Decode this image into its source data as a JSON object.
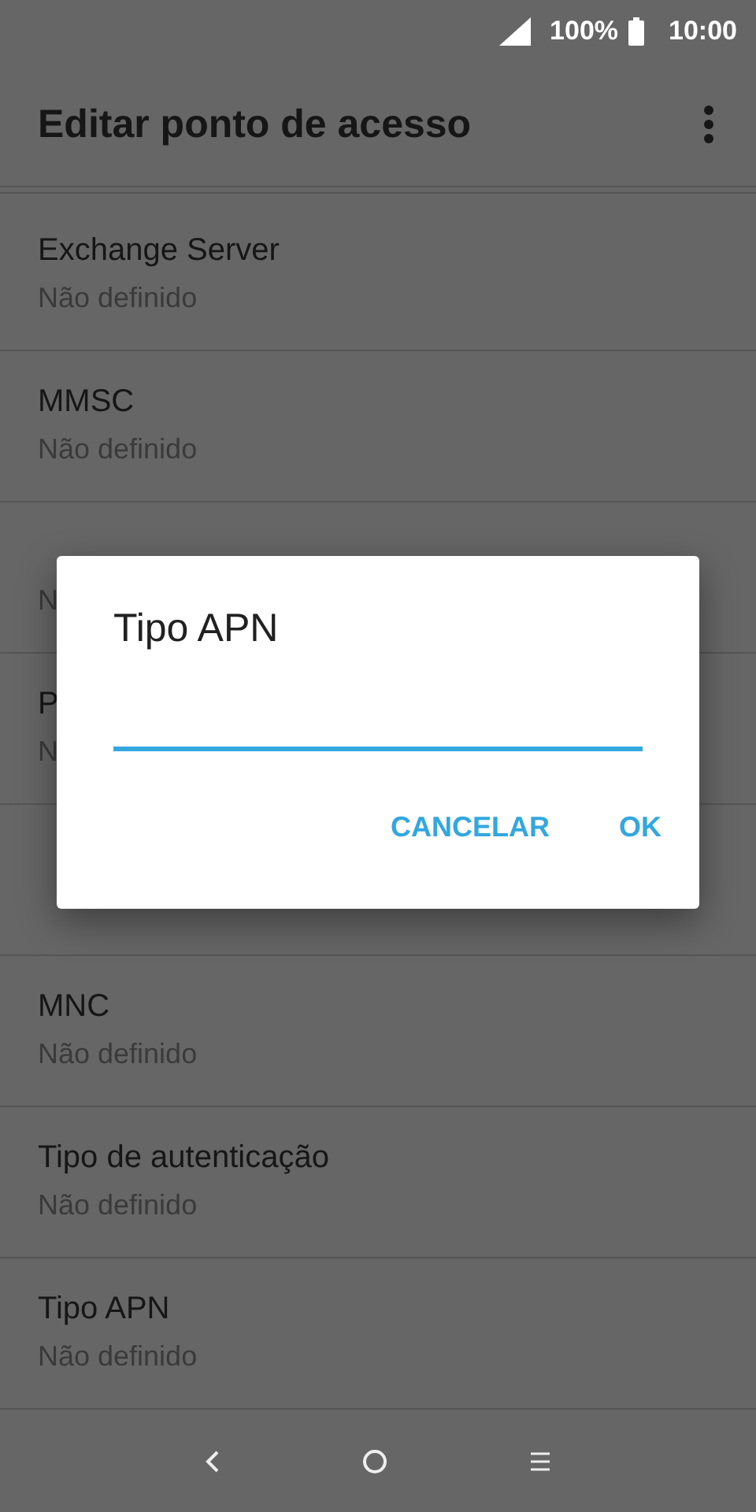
{
  "status_bar": {
    "battery": "100%",
    "time": "10:00"
  },
  "app_bar": {
    "title": "Editar ponto de acesso"
  },
  "settings": [
    {
      "kind": "item",
      "title": "Exchange Server",
      "summary": "Não definido"
    },
    {
      "kind": "item",
      "title": "MMSC",
      "summary": "Não definido"
    },
    {
      "kind": "item",
      "summary": "N"
    },
    {
      "kind": "item",
      "title": "P",
      "summary": "N"
    },
    {
      "kind": "covered"
    },
    {
      "kind": "item",
      "title": "MNC",
      "summary": "Não definido"
    },
    {
      "kind": "item",
      "title": "Tipo de autenticação",
      "summary": "Não definido"
    },
    {
      "kind": "item",
      "title": "Tipo APN",
      "summary": "Não definido"
    }
  ],
  "dialog": {
    "title": "Tipo APN",
    "buttons": [
      "CANCELAR",
      "OK"
    ]
  }
}
